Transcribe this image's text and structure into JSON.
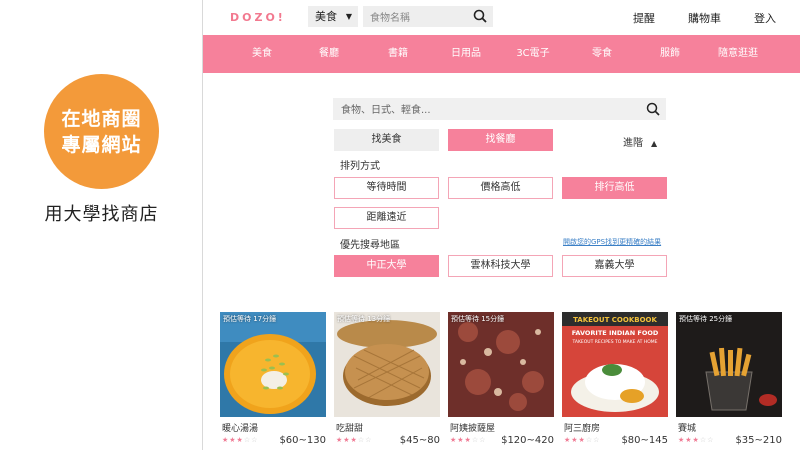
{
  "promo": {
    "circle_line1": "在地商圈",
    "circle_line2": "專屬網站",
    "caption": "用大學找商店",
    "accent": "#f39a3a"
  },
  "header": {
    "logo": "DOZO!",
    "category_select": "美食",
    "name_search_placeholder": "食物名稱",
    "links": [
      "提醒",
      "購物車",
      "登入"
    ]
  },
  "nav": {
    "color": "#f6819b",
    "items": [
      "美食",
      "餐廳",
      "書籍",
      "日用品",
      "3C電子",
      "零食",
      "服飾",
      "隨意逛逛"
    ]
  },
  "search": {
    "placeholder": "食物、日式、輕食..."
  },
  "mode": {
    "find_food": "找美食",
    "find_restaurant": "找餐廳",
    "advanced": "進階"
  },
  "sort": {
    "title": "排列方式",
    "options": [
      "等待時間",
      "價格高低",
      "排行高低",
      "距離遠近"
    ],
    "selected": "排行高低"
  },
  "area": {
    "title": "優先搜尋地區",
    "gps_link": "開啟您的GPS找到更精確的結果",
    "options": [
      "中正大學",
      "雲林科技大學",
      "嘉義大學"
    ],
    "selected": "中正大學"
  },
  "cards": [
    {
      "wait": "預估等待 17分鐘",
      "name": "暖心湯湯",
      "rating": 3,
      "price": "$60~130"
    },
    {
      "wait": "預估等待 13分鐘",
      "name": "吃甜甜",
      "rating": 3,
      "price": "$45~80"
    },
    {
      "wait": "預估等待 15分鐘",
      "name": "阿姨披薩屋",
      "rating": 3,
      "price": "$120~420",
      "photo_text": ""
    },
    {
      "wait": "",
      "name": "阿三廚房",
      "rating": 3,
      "price": "$80~145",
      "photo_text": "TAKEOUT COOKBOOK FAVORITE INDIAN FOOD TAKEOUT RECIPES TO MAKE AT HOME"
    },
    {
      "wait": "預估等待 25分鐘",
      "name": "賽城",
      "rating": 3,
      "price": "$35~210"
    }
  ]
}
